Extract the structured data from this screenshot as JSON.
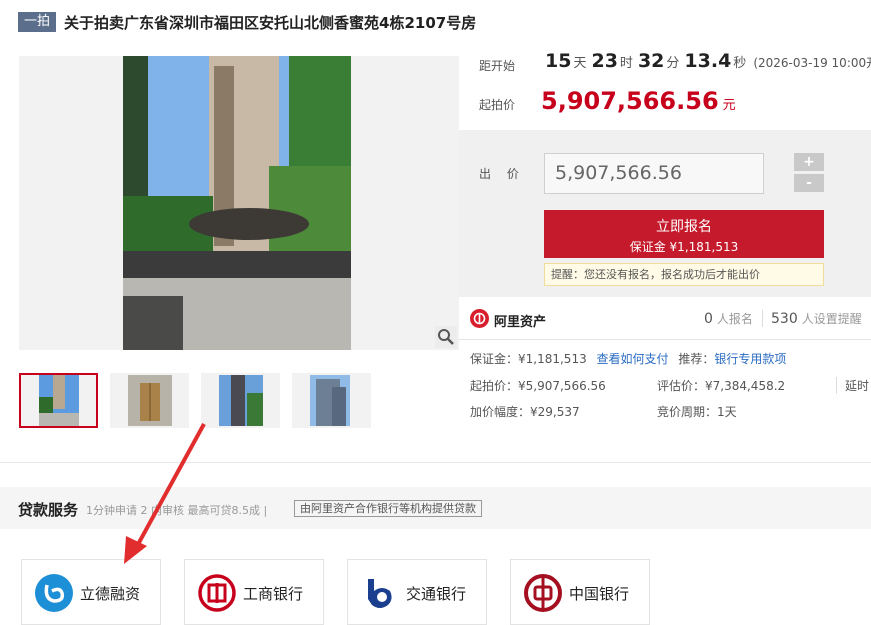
{
  "header": {
    "tag": "一拍",
    "title": "关于拍卖广东省深圳市福田区安托山北侧香蜜苑4栋2107号房"
  },
  "countdown": {
    "label": "距开始",
    "days": "15",
    "days_unit": "天",
    "hours": "23",
    "hours_unit": "时",
    "minutes": "32",
    "minutes_unit": "分",
    "seconds": "13.4",
    "seconds_unit": "秒",
    "start_time": "(2026-03-19 10:00开拍)"
  },
  "starting_price": {
    "label": "起拍价",
    "value": "5,907,566.56",
    "unit": "元"
  },
  "bid": {
    "label": "出 价",
    "input_value": "5,907,566.56",
    "plus": "+",
    "minus": "-",
    "signup_main": "立即报名",
    "signup_sub": "保证金 ¥1,181,513",
    "notice": "提醒：您还没有报名，报名成功后才能出价"
  },
  "ali": {
    "name": "阿里资产",
    "signup_count": "0",
    "signup_label": "人报名",
    "reminder_count": "530",
    "reminder_label": "人设置提醒"
  },
  "details": {
    "deposit": "保证金：¥1,181,513",
    "how_to_pay": "查看如何支付",
    "recommend_label": "推荐：",
    "bank_loan": "银行专用款项",
    "start_price": "起拍价：¥5,907,566.56",
    "appraisal": "评估价：¥7,384,458.2",
    "delay": "延时",
    "increment": "加价幅度：¥29,537",
    "period": "竞价周期：1天"
  },
  "loan": {
    "title": "贷款服务",
    "subtitle": "1分钟申请 2 内审核 最高可贷8.5成 |",
    "badge": "由阿里资产合作银行等机构提供贷款"
  },
  "banks": [
    {
      "name": "立德融资",
      "color": "#1d8fd6"
    },
    {
      "name": "工商银行",
      "color": "#c7001b"
    },
    {
      "name": "交通银行",
      "color": "#1b3f8f"
    },
    {
      "name": "中国银行",
      "color": "#a4101f"
    }
  ],
  "colors": {
    "accent": "#c7001b",
    "signup": "#c41a2b",
    "link": "#2a6cc3",
    "tag": "#5b6f8d"
  }
}
